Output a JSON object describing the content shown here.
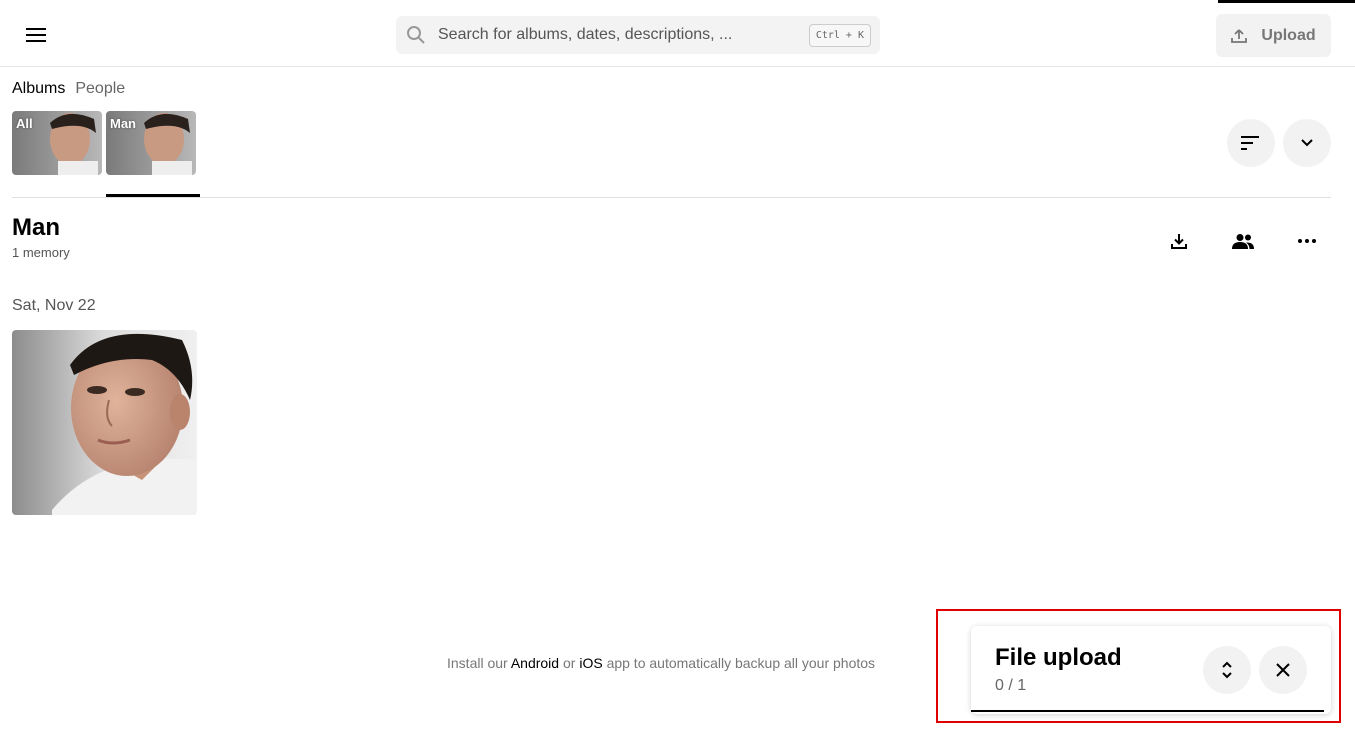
{
  "header": {
    "search_placeholder": "Search for albums, dates, descriptions, ...",
    "search_shortcut": "Ctrl + K",
    "upload_label": "Upload"
  },
  "album_tabs": {
    "albums": "Albums",
    "people": "People"
  },
  "albums": [
    {
      "label": "All",
      "selected": false
    },
    {
      "label": "Man",
      "selected": true
    }
  ],
  "album": {
    "title": "Man",
    "count": "1 memory"
  },
  "photos": {
    "date_label": "Sat, Nov 22"
  },
  "footer": {
    "prefix": "Install our",
    "android": "Android",
    "or": "or",
    "ios": "iOS",
    "suffix": "app to automatically backup all your photos"
  },
  "upload_panel": {
    "title": "File upload",
    "count": "0 / 1"
  },
  "colors": {
    "highlight": "#e00000",
    "button_bg": "#f2f2f2"
  },
  "icons": [
    "menu-icon",
    "search-icon",
    "upload-icon",
    "sort-icon",
    "chevron-down-icon",
    "download-icon",
    "people-icon",
    "more-icon",
    "expand-icon",
    "close-icon"
  ]
}
